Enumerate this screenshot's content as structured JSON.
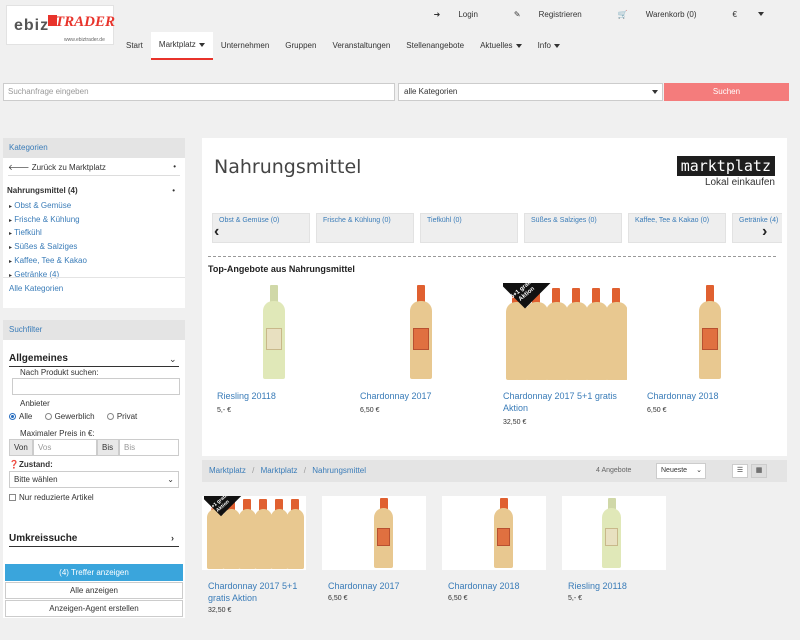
{
  "header": {
    "logo": {
      "part1": "ebiz",
      "part2": "TRADER",
      "url": "www.ebiztrader.de"
    },
    "utils": [
      {
        "icon": "login-icon",
        "label": "Login"
      },
      {
        "icon": "register-icon",
        "label": "Registrieren"
      },
      {
        "icon": "cart-icon",
        "label": "Warenkorb (0)"
      },
      {
        "icon": "currency",
        "label": "€"
      }
    ],
    "nav": [
      {
        "label": "Start"
      },
      {
        "label": "Marktplatz",
        "active": true,
        "dropdown": true
      },
      {
        "label": "Unternehmen"
      },
      {
        "label": "Gruppen"
      },
      {
        "label": "Veranstaltungen"
      },
      {
        "label": "Stellenangebote"
      },
      {
        "label": "Aktuelles",
        "dropdown": true
      },
      {
        "label": "Info",
        "dropdown": true
      }
    ]
  },
  "search": {
    "placeholder": "Suchanfrage eingeben",
    "category": "alle Kategorien",
    "button": "Suchen",
    "button_color": "#f47c7c"
  },
  "sidebar": {
    "categories_title": "Kategorien",
    "back": "Zurück zu Marktplatz",
    "current": "Nahrungsmittel (4)",
    "items": [
      "Obst & Gemüse",
      "Frische & Kühlung",
      "Tiefkühl",
      "Süßes & Salziges",
      "Kaffee, Tee & Kakao",
      "Getränke (4)"
    ],
    "all": "Alle Kategorien",
    "filter_title": "Suchfilter",
    "general": "Allgemeines",
    "product_search": "Nach Produkt suchen:",
    "provider": "Anbieter",
    "provider_options": [
      "Alle",
      "Gewerblich",
      "Privat"
    ],
    "max_price": "Maximaler Preis in €:",
    "from": "Von",
    "from_ph": "Vos",
    "to": "Bis",
    "to_ph": "Bis",
    "condition": "Zustand:",
    "condition_value": "Bitte wählen",
    "reduced": "Nur reduzierte Artikel",
    "radius": "Umkreissuche",
    "show_hits": "(4) Treffer anzeigen",
    "show_all": "Alle anzeigen",
    "agent": "Anzeigen-Agent erstellen"
  },
  "main": {
    "title": "Nahrungsmittel",
    "brand": "marktplatz",
    "brand_sub": "Lokal einkaufen",
    "categories": [
      "Obst & Gemüse (0)",
      "Frische & Kühlung (0)",
      "Tiefkühl (0)",
      "Süßes & Salziges (0)",
      "Kaffee, Tee & Kakao (0)",
      "Getränke (4)"
    ],
    "top_title": "Top-Angebote aus Nahrungsmittel",
    "top_products": [
      {
        "title": "Riesling 20118",
        "price": "5,- €"
      },
      {
        "title": "Chardonnay 2017",
        "price": "6,50 €"
      },
      {
        "title": "Chardonnay 2017 5+1 gratis Aktion",
        "price": "32,50 €",
        "badge": "5+1 gratis Aktion"
      },
      {
        "title": "Chardonnay 2018",
        "price": "6,50 €"
      }
    ]
  },
  "listing": {
    "breadcrumb": [
      "Marktplatz",
      "Marktplatz",
      "Nahrungsmittel"
    ],
    "count": "4 Angebote",
    "sort": "Neueste",
    "products": [
      {
        "title": "Chardonnay 2017 5+1 gratis Aktion",
        "price": "32,50 €",
        "badge": "5+1 gratis Aktion"
      },
      {
        "title": "Chardonnay 2017",
        "price": "6,50 €"
      },
      {
        "title": "Chardonnay 2018",
        "price": "6,50 €"
      },
      {
        "title": "Riesling 20118",
        "price": "5,- €"
      }
    ]
  }
}
